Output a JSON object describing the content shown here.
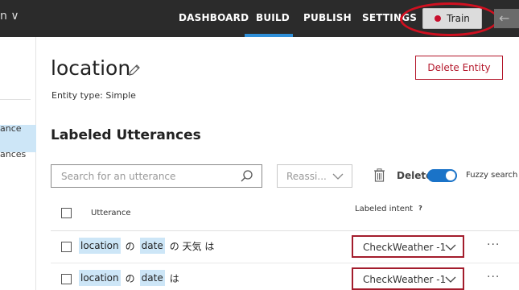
{
  "topbar": {
    "nav": [
      "DASHBOARD",
      "BUILD",
      "PUBLISH",
      "SETTINGS"
    ],
    "active_nav": "BUILD",
    "train_label": "Train",
    "back_glyph": "←",
    "left_glyph": "n ∨"
  },
  "sidebar": {
    "items": [
      "ance",
      "ances"
    ]
  },
  "entity": {
    "name": "location",
    "type_text": "Entity type: Simple",
    "delete_label": "Delete Entity"
  },
  "utterances": {
    "section_title": "Labeled Utterances",
    "search_placeholder": "Search for an utterance",
    "reassign_label": "Reassi...",
    "delete_label": "Delete",
    "fuzzy_label": "Fuzzy search",
    "fuzzy_on": true,
    "col_utterance": "Utterance",
    "col_intent": "Labeled intent",
    "help_glyph": "?",
    "rows": [
      {
        "tokens": [
          {
            "text": "location",
            "entity": true
          },
          {
            "text": "の",
            "entity": false
          },
          {
            "text": "date",
            "entity": true
          },
          {
            "text": "の 天気 は",
            "entity": false
          }
        ],
        "intent": "CheckWeather -1",
        "more": "···"
      },
      {
        "tokens": [
          {
            "text": "location",
            "entity": true
          },
          {
            "text": "の",
            "entity": false
          },
          {
            "text": "date",
            "entity": true
          },
          {
            "text": "は",
            "entity": false
          }
        ],
        "intent": "CheckWeather -1",
        "more": "···"
      }
    ]
  },
  "colors": {
    "topbar_bg": "#2b2b2b",
    "accent_blue": "#2f8fd8",
    "danger_red": "#b4172b",
    "entity_highlight": "#cde6f7",
    "annotation_ring": "#d01020"
  }
}
